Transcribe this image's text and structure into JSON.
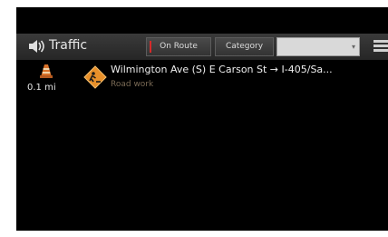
{
  "header": {
    "title": "Traffic",
    "on_route_label": "On Route",
    "category_label": "Category",
    "dropdown_value": "",
    "dropdown_arrow": "▾",
    "traffic_icon": "traffic-speaker-icon",
    "menu_icon": "menu-icon"
  },
  "incidents": [
    {
      "distance": "0.1 mi",
      "road": "Wilmington Ave (S) E Carson St → I-405/Sa...",
      "type": "Road work",
      "left_icon": "traffic-cone-icon",
      "sign_icon": "road-work-sign-icon"
    }
  ],
  "colors": {
    "screen_bg": "#000000",
    "header_bg": "#2e2e2e",
    "indicator_red": "#d62a2a",
    "sign_orange": "#e8902a",
    "subtext": "#7a6a55"
  }
}
